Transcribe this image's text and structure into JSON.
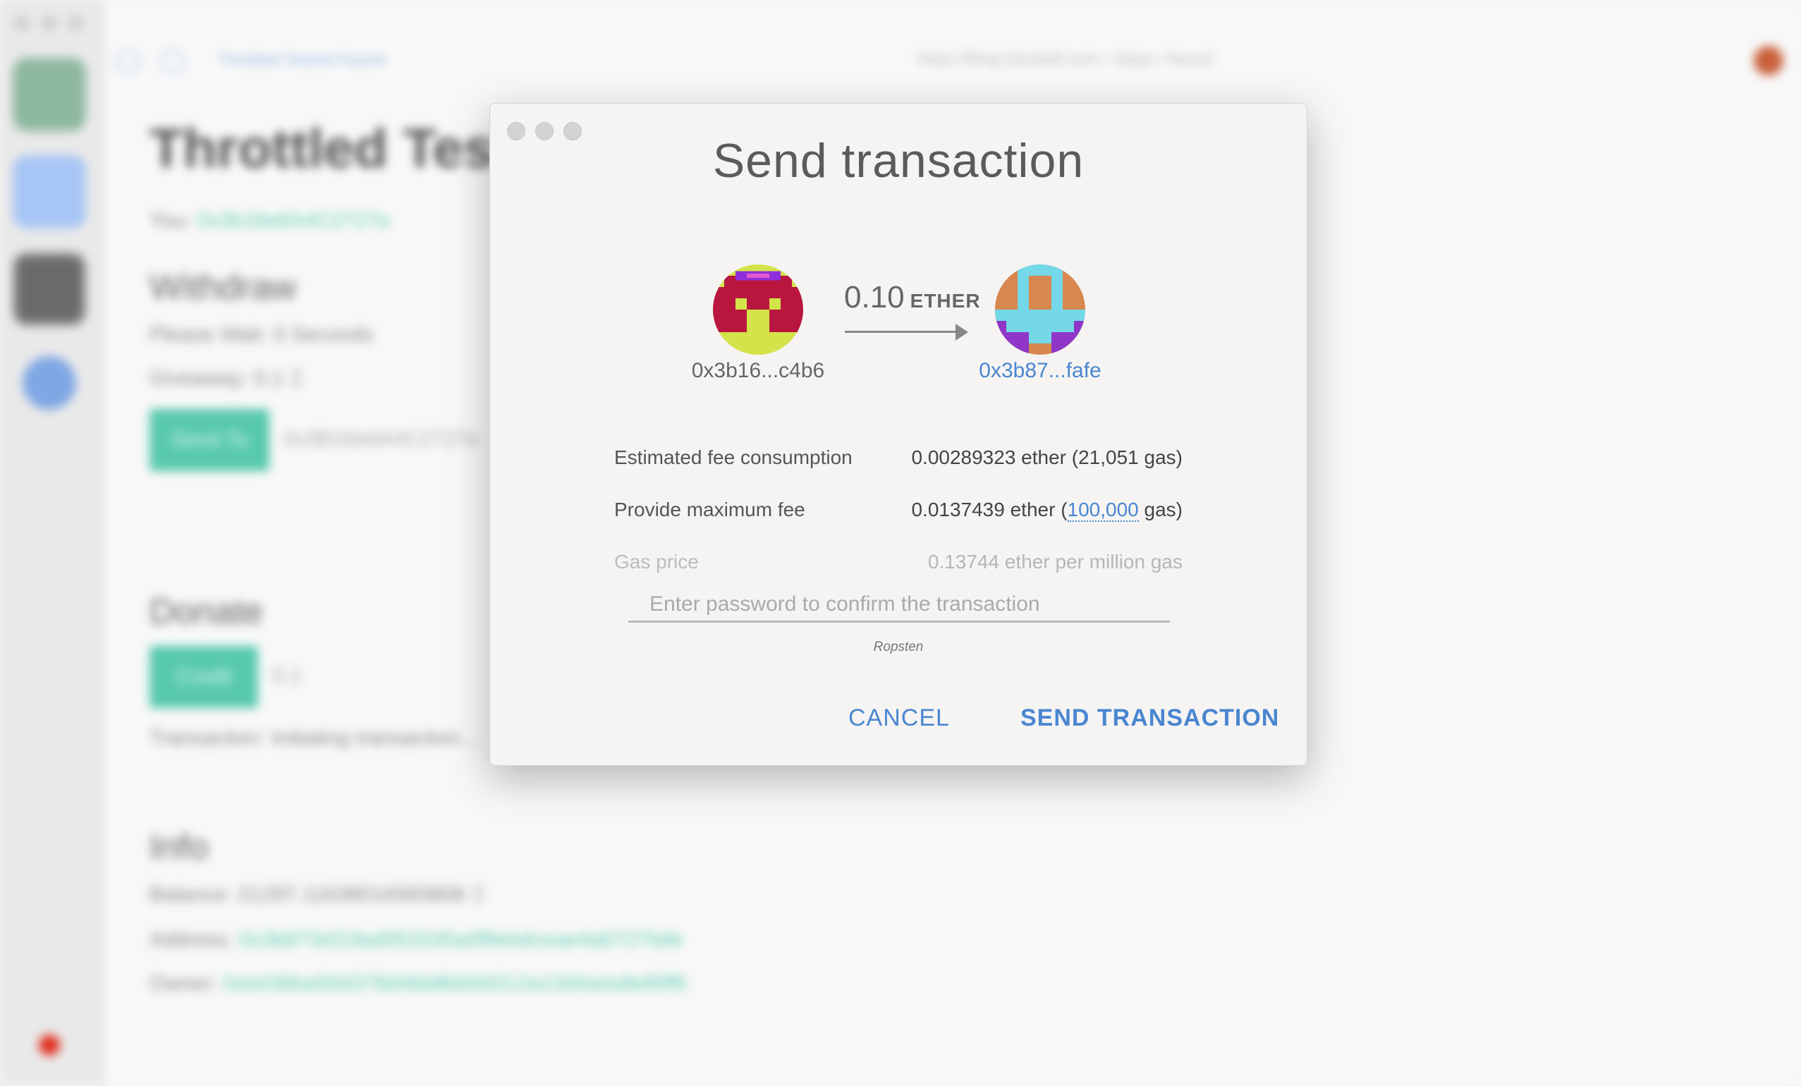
{
  "background": {
    "page_title": "Throttled Testnet Faucet",
    "url": "https://blog.fukuball.com • dapp • faucet",
    "heading": "Throttled Test",
    "you_label": "You:",
    "you_address": "0x3b16e6A4C2727e",
    "withdraw_heading": "Withdraw",
    "please_wait": "Please Wait: 0 Seconds",
    "giveaway": "Giveaway: 0.1 Ξ",
    "send_to_button": "Send To",
    "send_to_value": "0x3B16e6A4C2727e",
    "donate_heading": "Donate",
    "credit_button": "Credit",
    "credit_value": "0.1",
    "transaction_status": "Transaction: Initiating transaction... ",
    "info_heading": "Info",
    "balance": "Balance: 21297.11638016583806 Ξ",
    "address_label": "Address:",
    "address_value": "0x3b873ef19ad0532d5a0f9ebdceae4a6727fafe",
    "owner_label": "Owner:",
    "owner_value": "0xb436ba50d378d4bb8b60d312a13d4a4a9ef6ff6"
  },
  "dialog": {
    "title": "Send transaction",
    "amount": "0.10",
    "unit": "ETHER",
    "from_address": "0x3b16...c4b6",
    "to_address": "0x3b87...fafe",
    "rows": [
      {
        "label": "Estimated fee consumption",
        "value": "0.00289323 ether (21,051 gas)"
      },
      {
        "label": "Provide maximum fee",
        "value_prefix": "0.0137439 ether (",
        "value_link": "100,000",
        "value_suffix": " gas)"
      },
      {
        "label": "Gas price",
        "value": "0.13744 ether per million gas"
      }
    ],
    "password_placeholder": "Enter password to confirm the transaction",
    "network": "Ropsten",
    "cancel_label": "CANCEL",
    "send_label": "SEND TRANSACTION"
  },
  "colors": {
    "accent": "#4a86d0",
    "teal": "#58c9ae",
    "network_dot": "#e0301e"
  }
}
